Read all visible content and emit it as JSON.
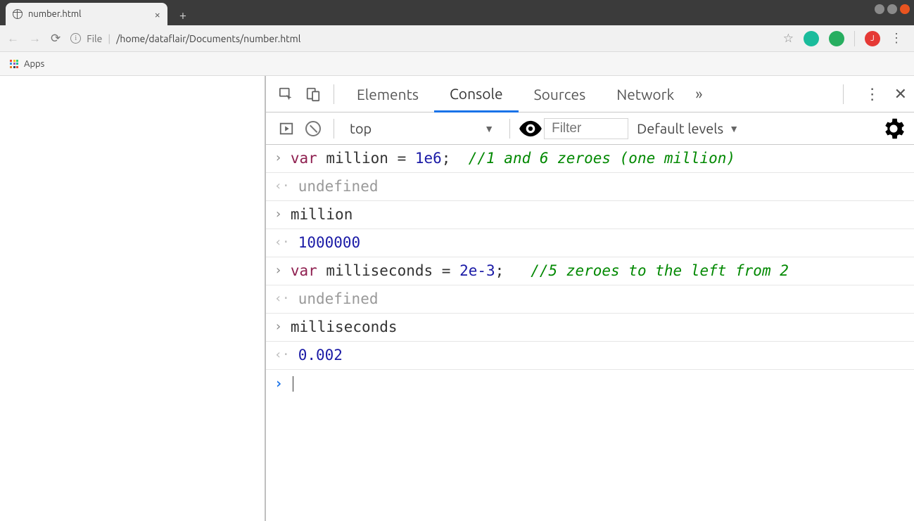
{
  "tab": {
    "title": "number.html"
  },
  "addr": {
    "file_label": "File",
    "path": "/home/dataflair/Documents/number.html",
    "avatar_letter": "J"
  },
  "apps_label": "Apps",
  "devtools": {
    "tabs": {
      "elements": "Elements",
      "console": "Console",
      "sources": "Sources",
      "network": "Network"
    },
    "context": "top",
    "filter_placeholder": "Filter",
    "levels_label": "Default levels"
  },
  "console": {
    "r1_kw": "var",
    "r1_rest": " million = ",
    "r1_num": "1e6",
    "r1_after": ";  ",
    "r1_comment": "//1 and 6 zeroes (one million)",
    "r2": "undefined",
    "r3": "million",
    "r4": "1000000",
    "r5_kw": "var",
    "r5_rest": " milliseconds = ",
    "r5_num": "2e-3",
    "r5_after": ";   ",
    "r5_comment": "//5 zeroes to the left from 2",
    "r6": "undefined",
    "r7": "milliseconds",
    "r8": "0.002"
  }
}
